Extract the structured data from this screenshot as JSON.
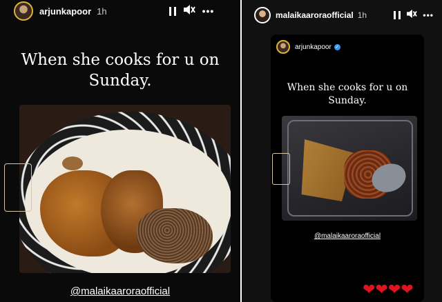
{
  "left_story": {
    "username": "arjunkapoor",
    "time": "1h",
    "caption": "When she cooks for u on Sunday.",
    "mention": "@malaikaaroraofficial"
  },
  "right_story": {
    "username": "malaikaaroraofficial",
    "time": "1h",
    "shared_post": {
      "username": "arjunkapoor",
      "caption": "When she cooks for u on Sunday.",
      "mention": "@malaikaaroraofficial"
    },
    "reaction": "❤❤❤❤"
  },
  "icons": {
    "pause": "pause-icon",
    "mute": "mute-icon",
    "more": "more-icon"
  },
  "colors": {
    "background": "#0a0a0a",
    "verified": "#3897f0",
    "heart": "#e0141e",
    "avatar_ring": "#e0b23a"
  }
}
